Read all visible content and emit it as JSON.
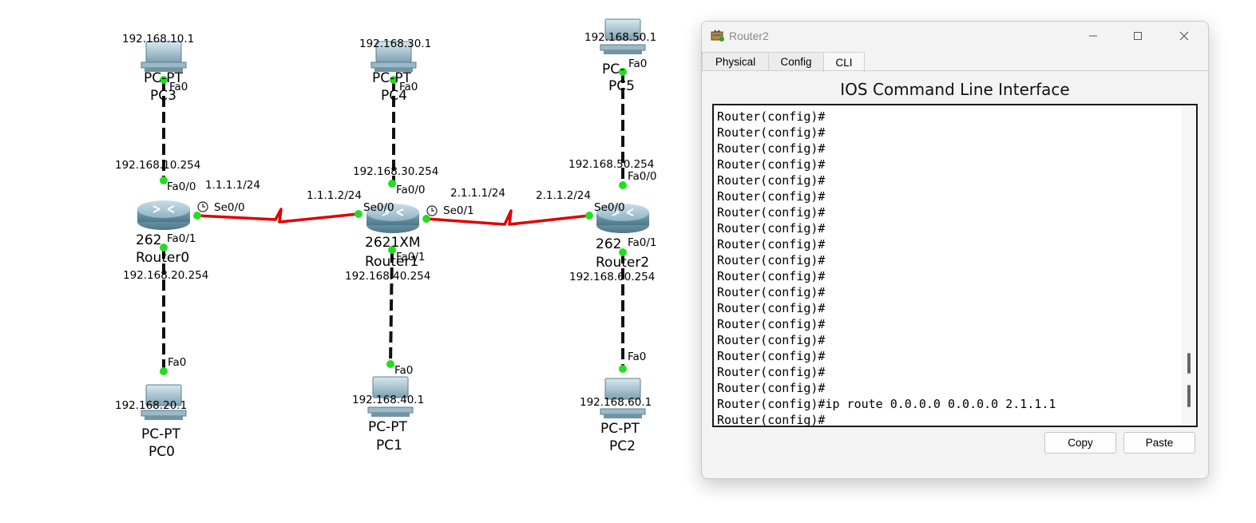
{
  "topology": {
    "pc_ips": {
      "pc3": "192.168.10.1",
      "pc4": "192.168.30.1",
      "pc5": "192.168.50.1",
      "pc0": "192.168.20.1",
      "pc1": "192.168.40.1",
      "pc2": "192.168.60.1"
    },
    "pc_types": {
      "pc3": "PC-PT",
      "pc4": "PC-PT",
      "pc5": "PC-",
      "pc0": "PC-PT",
      "pc1": "PC-PT",
      "pc2": "PC-PT"
    },
    "pc_names": {
      "pc3": "PC3",
      "pc4": "PC4",
      "pc5": "PC5",
      "pc0": "PC0",
      "pc1": "PC1",
      "pc2": "PC2"
    },
    "gateways": {
      "r0_top": "192.168.10.254",
      "r1_top": "192.168.30.254",
      "r2_top": "192.168.50.254",
      "r0_bottom": "192.168.20.254",
      "r1_bottom": "192.168.40.254",
      "r2_bottom": "192.168.60.254"
    },
    "serial_ips": {
      "r0_se": "1.1.1.1/24",
      "r1_left": "1.1.1.2/24",
      "r1_right": "2.1.1.1/24",
      "r2_se": "2.1.1.2/24"
    },
    "routers": {
      "r0_model": "262",
      "r0_name": "Router0",
      "r1_model": "2621XM",
      "r1_name": "Router1",
      "r2_model": "262",
      "r2_name": "Router2"
    },
    "ports": {
      "fa0": "Fa0",
      "fa0_0": "Fa0/0",
      "fa0_1": "Fa0/1",
      "se0_0": "Se0/0",
      "se0_1": "Se0/1"
    },
    "colors": {
      "serial_link": "#e00000",
      "ethernet_link": "#111111",
      "port_up": "#22dd22"
    }
  },
  "window": {
    "title": "Router2",
    "tabs": [
      {
        "label": "Physical"
      },
      {
        "label": "Config"
      },
      {
        "label": "CLI",
        "active": true
      }
    ],
    "heading": "IOS Command Line Interface",
    "console_lines": "Router(config)#\nRouter(config)#\nRouter(config)#\nRouter(config)#\nRouter(config)#\nRouter(config)#\nRouter(config)#\nRouter(config)#\nRouter(config)#\nRouter(config)#\nRouter(config)#\nRouter(config)#\nRouter(config)#\nRouter(config)#\nRouter(config)#\nRouter(config)#\nRouter(config)#\nRouter(config)#\nRouter(config)#ip route 0.0.0.0 0.0.0.0 2.1.1.1\nRouter(config)#",
    "buttons": {
      "copy": "Copy",
      "paste": "Paste"
    },
    "icons": {
      "app": "router-app-icon",
      "minimize": "minimize-icon",
      "maximize": "maximize-icon",
      "close": "close-icon"
    }
  }
}
